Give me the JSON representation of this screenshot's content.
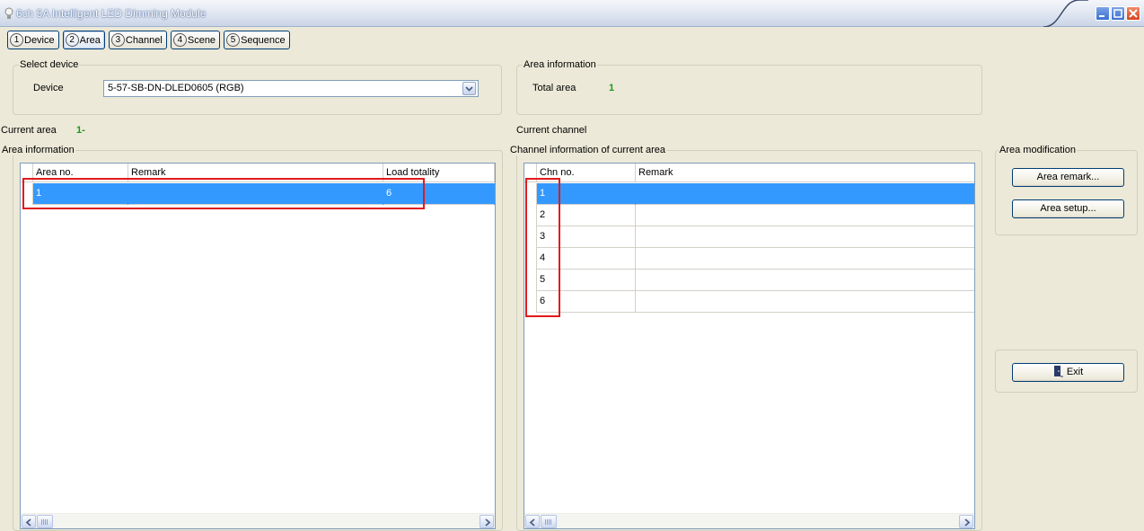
{
  "window": {
    "title": "6ch 5A Intelligent LED Dimming Module"
  },
  "tabs": [
    {
      "num": "1",
      "label": "Device"
    },
    {
      "num": "2",
      "label": "Area"
    },
    {
      "num": "3",
      "label": "Channel"
    },
    {
      "num": "4",
      "label": "Scene"
    },
    {
      "num": "5",
      "label": "Sequence"
    }
  ],
  "select_device": {
    "legend": "Select device",
    "device_label": "Device",
    "device_value": "5-57-SB-DN-DLED0605 (RGB)"
  },
  "area_info_top": {
    "legend": "Area information",
    "total_label": "Total area",
    "total_value": "1"
  },
  "current_area": {
    "label": "Current area",
    "value": "1-"
  },
  "current_channel": {
    "label": "Current channel"
  },
  "area_grid": {
    "legend": "Area information",
    "columns": [
      "Area no.",
      "Remark",
      "Load totality"
    ],
    "rows": [
      {
        "area_no": "1",
        "remark": "",
        "load": "6"
      }
    ]
  },
  "channel_grid": {
    "legend": "Channel information of current area",
    "columns": [
      "Chn no.",
      "Remark"
    ],
    "rows": [
      {
        "chn": "1",
        "remark": ""
      },
      {
        "chn": "2",
        "remark": ""
      },
      {
        "chn": "3",
        "remark": ""
      },
      {
        "chn": "4",
        "remark": ""
      },
      {
        "chn": "5",
        "remark": ""
      },
      {
        "chn": "6",
        "remark": ""
      }
    ]
  },
  "area_modification": {
    "legend": "Area modification",
    "remark_button": "Area remark...",
    "setup_button": "Area setup..."
  },
  "exit_button": "Exit",
  "colors": {
    "selection": "#3399ff",
    "highlight": "#e21a1a",
    "value_green": "#1a9a1a"
  }
}
